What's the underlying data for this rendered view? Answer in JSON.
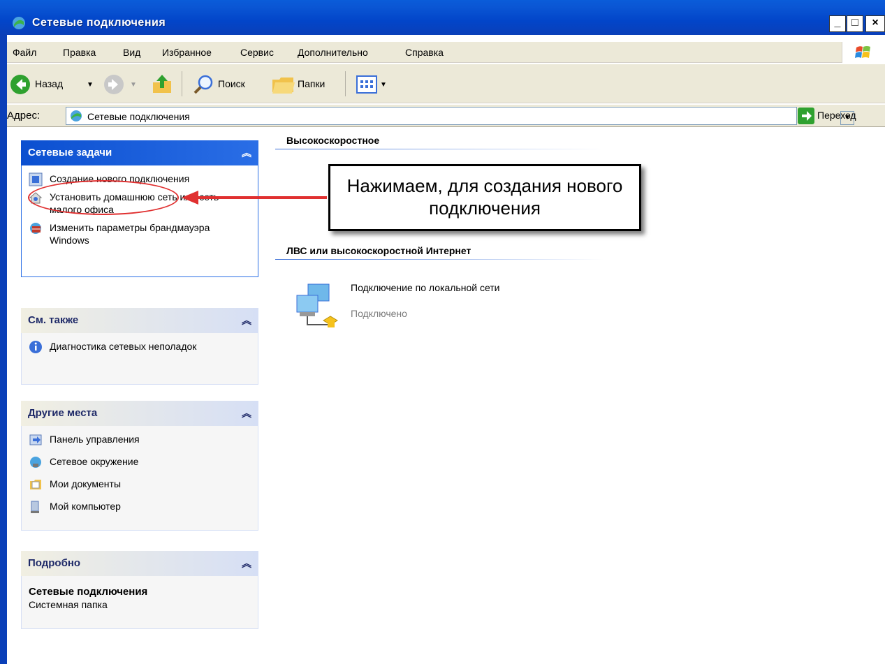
{
  "window": {
    "title": "Сетевые подключения",
    "min": "_",
    "max": "□",
    "close": "×"
  },
  "menu": [
    "Файл",
    "Правка",
    "Вид",
    "Избранное",
    "Сервис",
    "Дополнительно",
    "Справка"
  ],
  "toolbar": {
    "back": "Назад",
    "search": "Поиск",
    "folders": "Папки"
  },
  "address": {
    "label": "Адрес:",
    "value": "Сетевые подключения",
    "go": "Переход"
  },
  "panes": {
    "tasks": {
      "title": "Сетевые задачи",
      "items": [
        "Создание нового подключения",
        "Установить домашнюю сеть или сеть малого офиса",
        "Изменить параметры брандмауэра Windows"
      ]
    },
    "see_also": {
      "title": "См. также",
      "items": [
        "Диагностика сетевых неполадок"
      ]
    },
    "other": {
      "title": "Другие места",
      "items": [
        "Панель управления",
        "Сетевое окружение",
        "Мои документы",
        "Мой компьютер"
      ]
    },
    "details": {
      "title": "Подробно",
      "name": "Сетевые подключения",
      "type": "Системная папка"
    }
  },
  "groups": {
    "high_speed": "Высокоскоростное",
    "lan": "ЛВС или высокоскоростной Интернет"
  },
  "lan_connection": {
    "name": "Подключение по локальной сети",
    "status": "Подключено"
  },
  "annotation": {
    "text": "Нажимаем, для создания нового подключения"
  },
  "colors": {
    "titlebar": "#0245c9",
    "accent_blue": "#2a6ee6",
    "annotation_red": "#e03030"
  }
}
